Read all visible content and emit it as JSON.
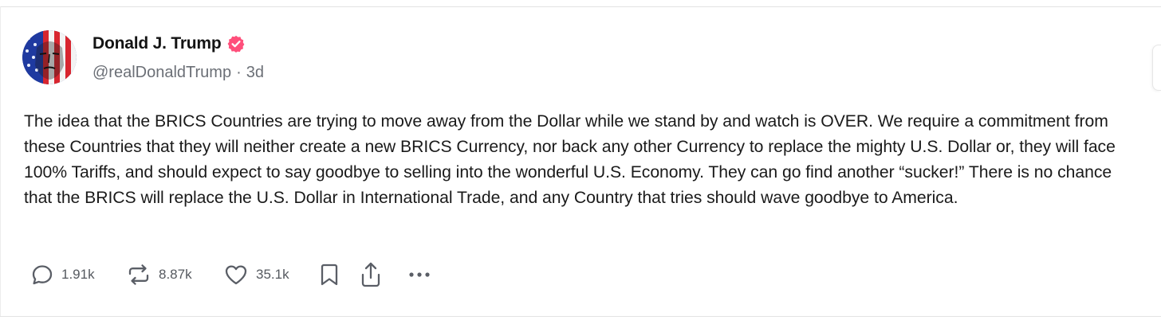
{
  "post": {
    "author": {
      "display_name": "Donald J. Trump",
      "handle": "@realDonaldTrump",
      "separator": "·",
      "time_ago": "3d",
      "verified_color": "#ff4f7b"
    },
    "body": "The idea that the BRICS Countries are trying to move away from the Dollar while we stand by and watch is OVER. We require a commitment from these Countries that they will neither create a new BRICS Currency, nor back any other Currency to replace the mighty U.S. Dollar or, they will face 100% Tariffs, and should expect to say goodbye to selling into the wonderful U.S. Economy. They can go find another “sucker!” There is no chance that the BRICS will replace the U.S. Dollar in International Trade, and any Country that tries should wave goodbye to America.",
    "actions": {
      "reply": {
        "icon": "reply-icon",
        "count": "1.91k"
      },
      "repost": {
        "icon": "repost-icon",
        "count": "8.87k"
      },
      "like": {
        "icon": "heart-icon",
        "count": "35.1k"
      },
      "save": {
        "icon": "bookmark-icon"
      },
      "share": {
        "icon": "share-icon"
      },
      "more": {
        "icon": "more-icon"
      }
    }
  },
  "colors": {
    "text": "#1a1a1a",
    "muted": "#6b6f76",
    "accent": "#ff4f7b"
  }
}
